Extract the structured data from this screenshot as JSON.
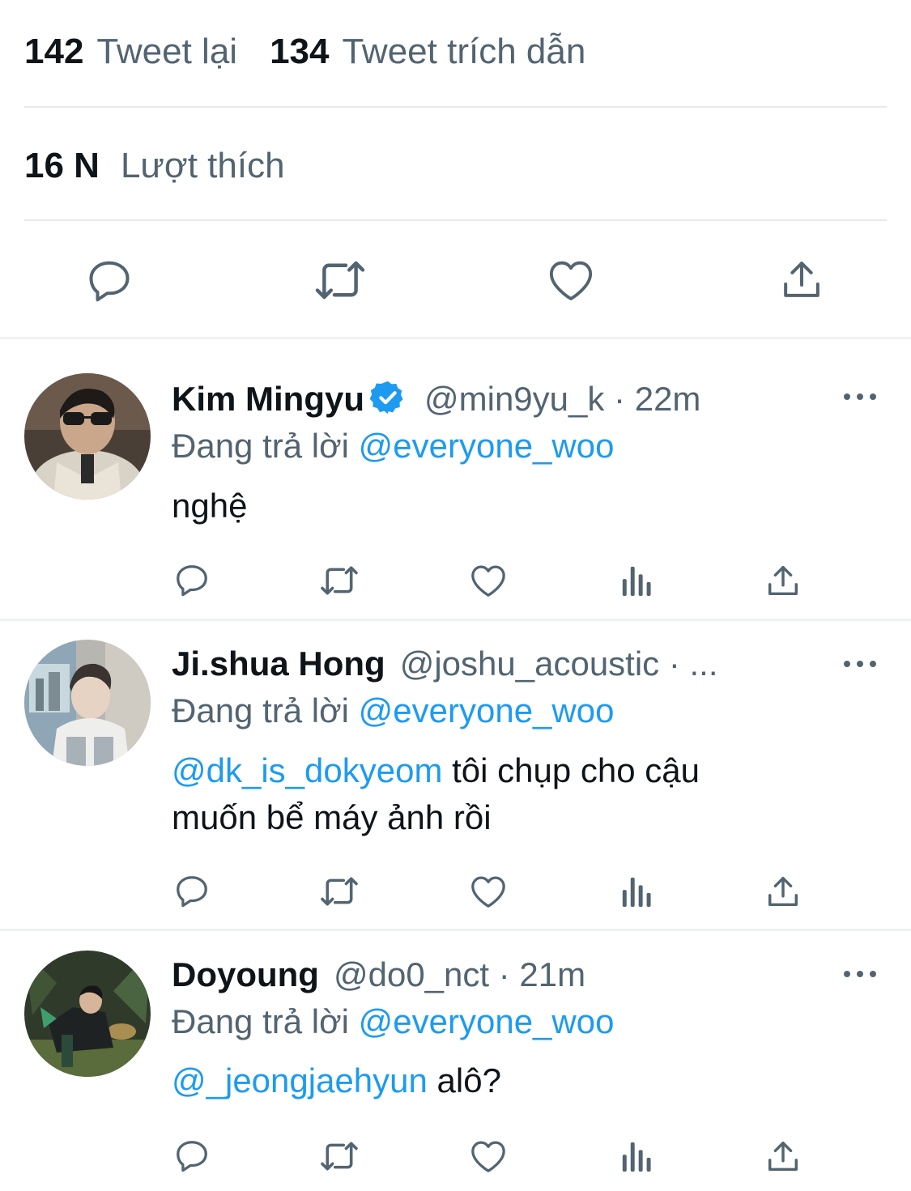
{
  "stats": {
    "retweets_count": "142",
    "retweets_label": "Tweet lại",
    "quotes_count": "134",
    "quotes_label": "Tweet trích dẫn",
    "likes_count": "16 N",
    "likes_label": "Lượt thích"
  },
  "action_icons": [
    "reply-icon",
    "retweet-icon",
    "like-icon",
    "share-icon"
  ],
  "reply_action_icons": [
    "reply-icon",
    "retweet-icon",
    "like-icon",
    "analytics-icon",
    "share-icon"
  ],
  "colors": {
    "text": "#0f1419",
    "secondary": "#536471",
    "link": "#1d9bf0",
    "divider": "#e7e9ea",
    "verified": "#1d9bf0"
  },
  "replies": [
    {
      "name": "Kim Mingyu",
      "verified": true,
      "meta": "@min9yu_k · 22m",
      "replying_prefix": "Đang trả lời ",
      "replying_to": "@everyone_woo",
      "text_line1": "nghệ"
    },
    {
      "name": "Ji.shua Hong",
      "verified": false,
      "meta": "@joshu_acoustic · ...",
      "replying_prefix": "Đang trả lời ",
      "replying_to": "@everyone_woo",
      "mention": "@dk_is_dokyeom",
      "text_line1": " tôi chụp cho cậu",
      "text_line2": "muốn bể máy ảnh rồi"
    },
    {
      "name": "Doyoung",
      "verified": false,
      "meta": "@do0_nct · 21m",
      "replying_prefix": "Đang trả lời ",
      "replying_to": "@everyone_woo",
      "mention": "@_jeongjaehyun",
      "text_line1": " alô?"
    }
  ]
}
